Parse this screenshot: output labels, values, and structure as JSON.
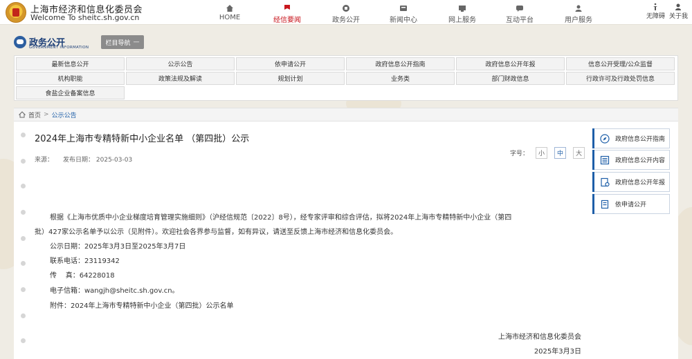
{
  "header": {
    "site_title": "上海市经济和信息化委员会",
    "site_url": "Welcome To sheitc.sh.gov.cn",
    "nav": [
      {
        "label": "HOME",
        "icon": "home-icon",
        "active": false
      },
      {
        "label": "经信要闻",
        "icon": "news-flag-icon",
        "active": true
      },
      {
        "label": "政务公开",
        "icon": "open-gov-icon",
        "active": false
      },
      {
        "label": "新闻中心",
        "icon": "newsroom-icon",
        "active": false
      },
      {
        "label": "网上服务",
        "icon": "online-service-icon",
        "active": false
      },
      {
        "label": "互动平台",
        "icon": "interaction-icon",
        "active": false
      },
      {
        "label": "用户服务",
        "icon": "user-service-icon",
        "active": false
      }
    ],
    "tools": [
      {
        "label": "无障碍",
        "icon": "accessibility-icon"
      },
      {
        "label": "关于我",
        "icon": "about-icon"
      }
    ],
    "accent_color": "#c8161d"
  },
  "section": {
    "title": "政务公开",
    "subtitle": "GOVERNMENT INFORMATION",
    "column_nav_label": "栏目导航",
    "column_nav_symbol": "—"
  },
  "grid_menu": [
    "最新信息公开",
    "公示公告",
    "依申请公开",
    "政府信息公开指南",
    "政府信息公开年报",
    "信息公开受理/公众监督",
    "机构职能",
    "政策法规及解读",
    "规划计划",
    "业务类",
    "部门财政信息",
    "行政许可及行政处罚信息",
    "食盐企业备案信息"
  ],
  "breadcrumb": {
    "home": "首页",
    "separator": ">",
    "current": "公示公告"
  },
  "article": {
    "title": "2024年上海市专精特新中小企业名单 （第四批）公示",
    "source_label": "来源：",
    "date_label": "发布日期：",
    "date": "2025-03-03",
    "font_size_label": "字号：",
    "font_sizes": [
      "小",
      "中",
      "大"
    ],
    "selected_font_size": "中",
    "paragraphs": [
      "根据《上海市优质中小企业梯度培育管理实施细则》（沪经信规范〔2022〕8号），经专家评审和综合评估，拟将2024年上海市专精特新中小企业（第四",
      "批）427家公示名单予以公示（见附件）。欢迎社会各界参与监督，如有异议，请送至反馈上海市经济和信息化委员会。",
      "公示日期：2025年3月3日至2025年3月7日",
      "联系电话：23119342",
      "传    真：64228018",
      "电子信箱：wangjh@sheitc.sh.gov.cn。",
      "附件：2024年上海市专精特新中小企业（第四批）公示名单"
    ],
    "signature_org": "上海市经济和信息化委员会",
    "signature_date": "2025年3月3日"
  },
  "side_links": [
    {
      "label": "政府信息公开指南",
      "icon": "compass-icon"
    },
    {
      "label": "政府信息公开内容",
      "icon": "list-icon"
    },
    {
      "label": "政府信息公开年报",
      "icon": "report-icon"
    },
    {
      "label": "依申请公开",
      "icon": "application-icon"
    }
  ]
}
